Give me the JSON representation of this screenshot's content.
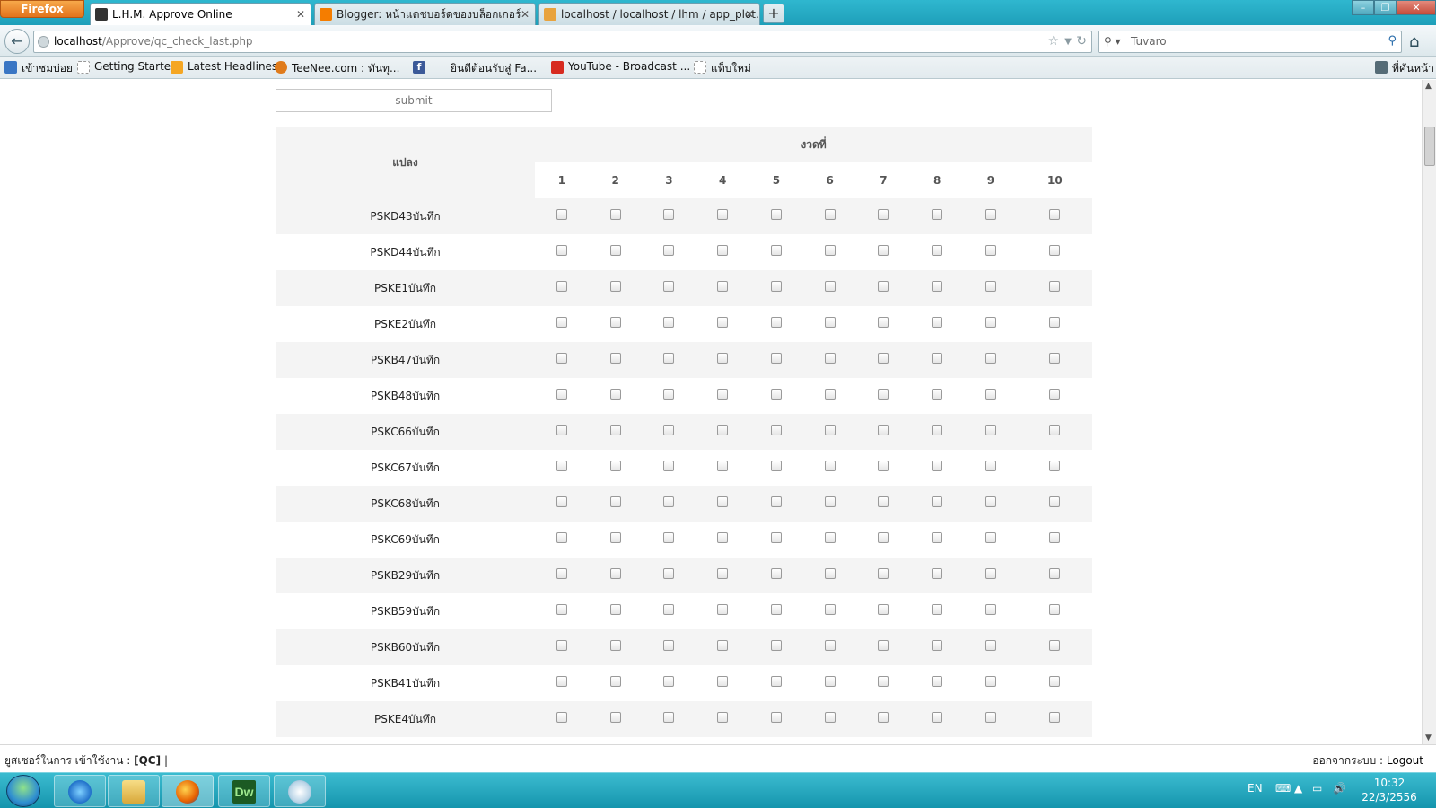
{
  "browser": {
    "menu_label": "Firefox",
    "tabs": [
      {
        "title": "L.H.M. Approve Online",
        "active": true
      },
      {
        "title": "Blogger: หน้าแดชบอร์ดของบล็อกเกอร์",
        "active": false
      },
      {
        "title": "localhost / localhost / lhm / app_plot...",
        "active": false
      }
    ],
    "url_host": "localhost",
    "url_path": "/Approve/qc_check_last.php",
    "search_placeholder": "Tuvaro",
    "bookmarks": [
      {
        "label": "เข้าชมบ่อย",
        "icon": "most-visited-icon",
        "color": "#3a76c4"
      },
      {
        "label": "Getting Started",
        "icon": "page-icon",
        "color": "#ffffff"
      },
      {
        "label": "Latest Headlines",
        "icon": "rss-icon",
        "color": "#f5a623"
      },
      {
        "label": "TeeNee.com : ทันทุ...",
        "icon": "teenee-icon",
        "color": "#e07b1b"
      },
      {
        "label": "",
        "icon": "facebook-icon",
        "color": "#3b5998"
      },
      {
        "label": "ยินดีต้อนรับสู่ Fa...",
        "icon": "page-icon",
        "color": "#ffffff"
      },
      {
        "label": "YouTube - Broadcast ...",
        "icon": "youtube-icon",
        "color": "#d72b20"
      },
      {
        "label": "แท็บใหม่",
        "icon": "page-icon",
        "color": "#ffffff"
      }
    ],
    "bookmarks_menu": "ที่คั่นหน้า"
  },
  "page": {
    "submit_label": "submit",
    "row_header": "แปลง",
    "round_header": "งวดที่",
    "rounds": [
      "1",
      "2",
      "3",
      "4",
      "5",
      "6",
      "7",
      "8",
      "9",
      "10"
    ],
    "lots": [
      "PSKD43บันทึก",
      "PSKD44บันทึก",
      "PSKE1บันทึก",
      "PSKE2บันทึก",
      "PSKB47บันทึก",
      "PSKB48บันทึก",
      "PSKC66บันทึก",
      "PSKC67บันทึก",
      "PSKC68บันทึก",
      "PSKC69บันทึก",
      "PSKB29บันทึก",
      "PSKB59บันทึก",
      "PSKB60บันทึก",
      "PSKB41บันทึก",
      "PSKE4บันทึก"
    ]
  },
  "footer": {
    "user_prefix": "ยูสเซอร์ในการ เข้าใช้งาน :",
    "user_name": "[QC]",
    "separator": "|",
    "logout_prefix": "ออกจากระบบ :",
    "logout_label": "Logout"
  },
  "taskbar": {
    "apps": [
      "internet-explorer-icon",
      "file-explorer-icon",
      "firefox-icon",
      "dreamweaver-icon",
      "paint-icon"
    ],
    "dw_label": "Dw",
    "language": "EN",
    "time": "10:32",
    "date": "22/3/2556"
  }
}
